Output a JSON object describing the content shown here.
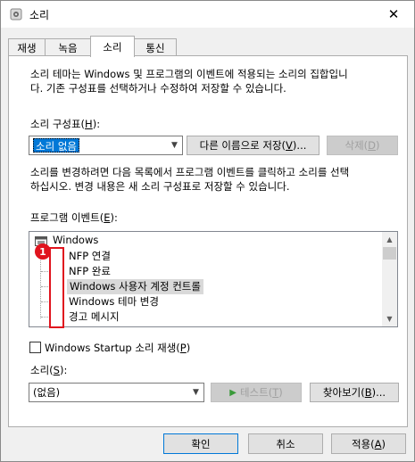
{
  "window": {
    "title": "소리",
    "close_glyph": "✕"
  },
  "tabs": [
    {
      "label": "재생"
    },
    {
      "label": "녹음"
    },
    {
      "label": "소리"
    },
    {
      "label": "통신"
    }
  ],
  "description": {
    "line1": "소리 테마는 Windows 및 프로그램의 이벤트에 적용되는 소리의 집합입니",
    "line2": "다. 기존 구성표를 선택하거나 수정하여 저장할 수 있습니다."
  },
  "scheme": {
    "label_prefix": "소리 구성표(",
    "label_key": "H",
    "label_suffix": "):",
    "selected": "소리 없음",
    "save_as_prefix": "다른 이름으로 저장(",
    "save_as_key": "V",
    "save_as_suffix": ")...",
    "delete_prefix": "삭제(",
    "delete_key": "D",
    "delete_suffix": ")"
  },
  "instruction": {
    "line1": "소리를 변경하려면 다음 목록에서 프로그램 이벤트를 클릭하고 소리를 선택",
    "line2": "하십시오. 변경 내용은 새 소리 구성표로 저장할 수 있습니다."
  },
  "events": {
    "label_prefix": "프로그램 이벤트(",
    "label_key": "E",
    "label_suffix": "):",
    "root": "Windows",
    "items": [
      "NFP 연결",
      "NFP 완료",
      "Windows 사용자 계정 컨트롤",
      "Windows 테마 변경",
      "경고 메시지"
    ]
  },
  "annotation": {
    "badge": "1",
    "color": "#e0141e"
  },
  "startup": {
    "label_prefix": "Windows Startup 소리 재생(",
    "label_key": "P",
    "label_suffix": ")",
    "checked": false
  },
  "sound": {
    "label_prefix": "소리(",
    "label_key": "S",
    "label_suffix": "):",
    "selected": "(없음)",
    "test_prefix": "테스트(",
    "test_key": "T",
    "test_suffix": ")",
    "browse_prefix": "찾아보기(",
    "browse_key": "B",
    "browse_suffix": ")..."
  },
  "footer": {
    "ok": "확인",
    "cancel": "취소",
    "apply_prefix": "적용(",
    "apply_key": "A",
    "apply_suffix": ")"
  },
  "colors": {
    "accent": "#0078d7",
    "highlight": "#d9d9d9",
    "play_icon": "#3a9a3a"
  }
}
